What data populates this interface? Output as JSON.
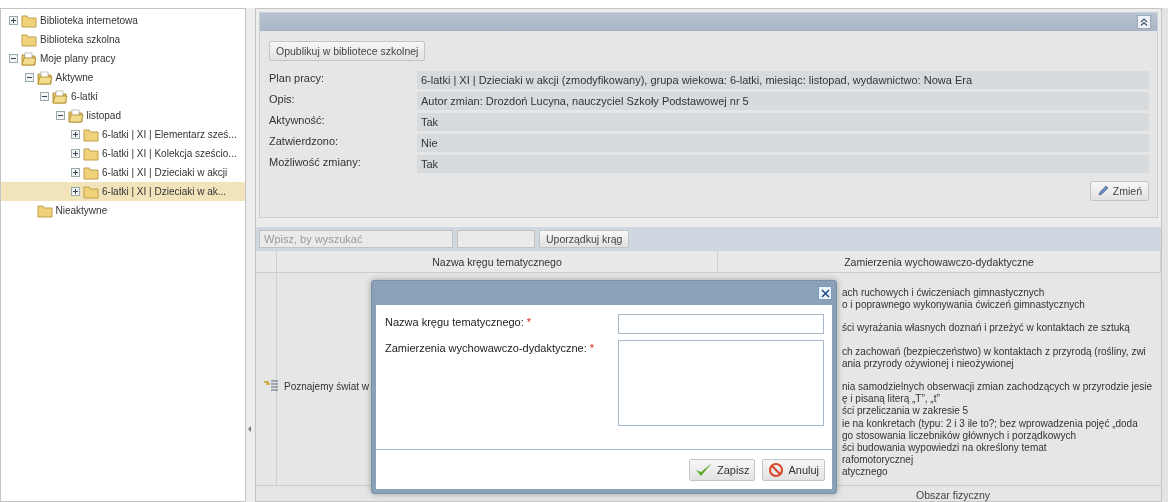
{
  "tree": [
    {
      "label": "Biblioteka internetowa",
      "has_toggle": true,
      "expanded": false,
      "selected": false
    },
    {
      "label": "Biblioteka szkolna",
      "has_toggle": false,
      "expanded": false,
      "selected": false
    },
    {
      "label": "Moje plany pracy",
      "has_toggle": true,
      "expanded": true,
      "selected": false,
      "children": [
        {
          "label": "Aktywne",
          "has_toggle": true,
          "expanded": true,
          "selected": false,
          "children": [
            {
              "label": "6-latki",
              "has_toggle": true,
              "expanded": true,
              "selected": false,
              "children": [
                {
                  "label": "listopad",
                  "has_toggle": true,
                  "expanded": true,
                  "selected": false,
                  "children": [
                    {
                      "label": "6-latki | XI | Elementarz sześ...",
                      "has_toggle": true,
                      "expanded": false,
                      "selected": false
                    },
                    {
                      "label": "6-latki | XI | Kolekcja sześcio...",
                      "has_toggle": true,
                      "expanded": false,
                      "selected": false
                    },
                    {
                      "label": "6-latki | XI | Dzieciaki w akcji",
                      "has_toggle": true,
                      "expanded": false,
                      "selected": false
                    },
                    {
                      "label": "6-latki | XI | Dzieciaki w ak...",
                      "has_toggle": true,
                      "expanded": false,
                      "selected": true
                    }
                  ]
                }
              ]
            }
          ]
        },
        {
          "label": "Nieaktywne",
          "has_toggle": false,
          "expanded": false,
          "selected": false
        }
      ]
    }
  ],
  "details": {
    "publish_button": "Opublikuj w bibliotece szkolnej",
    "fields": [
      {
        "label": "Plan pracy:",
        "value": "6-latki | XI | Dzieciaki w akcji (zmodyfikowany), grupa wiekowa: 6-latki, miesiąc: listopad, wydawnictwo: Nowa Era"
      },
      {
        "label": "Opis:",
        "value": "Autor zmian: Drozdoń Lucyna, nauczyciel Szkoły Podstawowej nr 5"
      },
      {
        "label": "Aktywność:",
        "value": "Tak"
      },
      {
        "label": "Zatwierdzono:",
        "value": "Nie"
      },
      {
        "label": "Możliwość zmiany:",
        "value": "Tak"
      }
    ],
    "change_button": "Zmień"
  },
  "toolbar": {
    "search_placeholder": "Wpisz, by wyszukać",
    "sort_button": "Uporządkuj krąg"
  },
  "table": {
    "columns": [
      "Nazwa kręgu tematycznego",
      "Zamierzenia wychowawczo-dydaktyczne"
    ],
    "rows": [
      {
        "name": "Poznajemy świat w",
        "goals": [
          {
            "text": "ach ruchowych i ćwiczeniach gimnastycznych",
            "gap_before": false
          },
          {
            "text": "o i poprawnego wykonywania ćwiczeń gimnastycznych",
            "gap_before": false
          },
          {
            "text": "ści wyrażania własnych doznań i przeżyć w kontaktach ze sztuką",
            "gap_before": true
          },
          {
            "text": "ch zachowań (bezpieczeństwo) w kontaktach z przyrodą (rośliny, zwi",
            "gap_before": true
          },
          {
            "text": "ania przyrody ożywionej i nieożywionej",
            "gap_before": false
          },
          {
            "text": "nia samodzielnych obserwacji zmian zachodzących w przyrodzie jesie",
            "gap_before": true
          },
          {
            "text": "ę i pisaną literą „T”, „t”",
            "gap_before": false
          },
          {
            "text": "ści przeliczania w zakresie 5",
            "gap_before": false
          },
          {
            "text": "ie na konkretach (typu: 2 i 3 ile to?; bez wprowadzenia pojęć „doda",
            "gap_before": false
          },
          {
            "text": "go stosowania liczebników głównych i porządkowych",
            "gap_before": false
          },
          {
            "text": "ści budowania wypowiedzi na określony temat",
            "gap_before": false
          },
          {
            "text": "rafomotorycznej",
            "gap_before": false
          },
          {
            "text": "atycznego",
            "gap_before": false
          }
        ]
      }
    ],
    "group_heading": "Obszar fizyczny"
  },
  "dialog": {
    "fields": [
      {
        "label": "Nazwa kręgu tematycznego:",
        "kind": "input",
        "required_mark": "*"
      },
      {
        "label": "Zamierzenia wychowawczo-dydaktyczne:",
        "kind": "textarea",
        "required_mark": "*"
      }
    ],
    "buttons": [
      {
        "label": "Zapisz",
        "kind": "save"
      },
      {
        "label": "Anuluj",
        "kind": "cancel"
      }
    ]
  }
}
